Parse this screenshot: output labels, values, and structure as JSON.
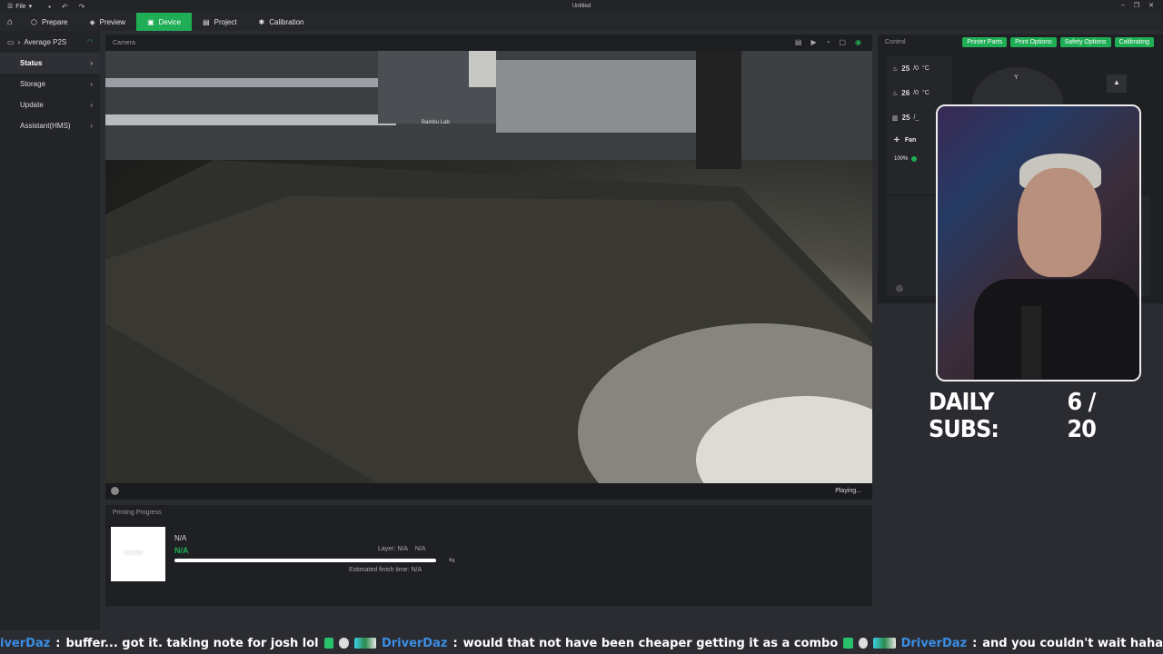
{
  "window": {
    "file_menu": "File",
    "title": "Untitled"
  },
  "tabs": [
    {
      "label": "Prepare"
    },
    {
      "label": "Preview"
    },
    {
      "label": "Device"
    },
    {
      "label": "Project"
    },
    {
      "label": "Calibration"
    }
  ],
  "colors": {
    "accent": "#1fae55",
    "link_user": "#3a8ee6"
  },
  "sidebar": {
    "device": "Average P2S",
    "items": [
      {
        "label": "Status"
      },
      {
        "label": "Storage"
      },
      {
        "label": "Update"
      },
      {
        "label": "Assistant(HMS)"
      }
    ]
  },
  "camera": {
    "header": "Camera",
    "status": "Playing...",
    "brand_text": "Bambu Lab"
  },
  "progress": {
    "header": "Printing Progress",
    "name": "N/A",
    "state": "N/A",
    "layer": "Layer: N/A",
    "percent": "N/A",
    "fill_fraction": 1.0,
    "finish": "Estimated finish time: N/A"
  },
  "control": {
    "header": "Control",
    "buttons": [
      "Printer Parts",
      "Print Options",
      "Safety Options",
      "Calibrating"
    ],
    "temps": [
      {
        "value": "25",
        "target": "/0",
        "unit": "°C"
      },
      {
        "value": "26",
        "target": "/0",
        "unit": "°C"
      },
      {
        "value": "25",
        "target": "/_",
        "unit": ""
      }
    ],
    "fan_label": "Fan",
    "speed": "100%",
    "jog_axis": "Y"
  },
  "overlay": {
    "subs_label": "DAILY SUBS:",
    "subs_value": "6 / 20"
  },
  "chat": [
    {
      "user": "iverDaz",
      "msg": "buffer... got it. taking note for josh lol"
    },
    {
      "user": "DriverDaz",
      "msg": "would that not have been cheaper getting it as a combo"
    },
    {
      "user": "DriverDaz",
      "msg": "and you couldn't wait haha"
    }
  ]
}
